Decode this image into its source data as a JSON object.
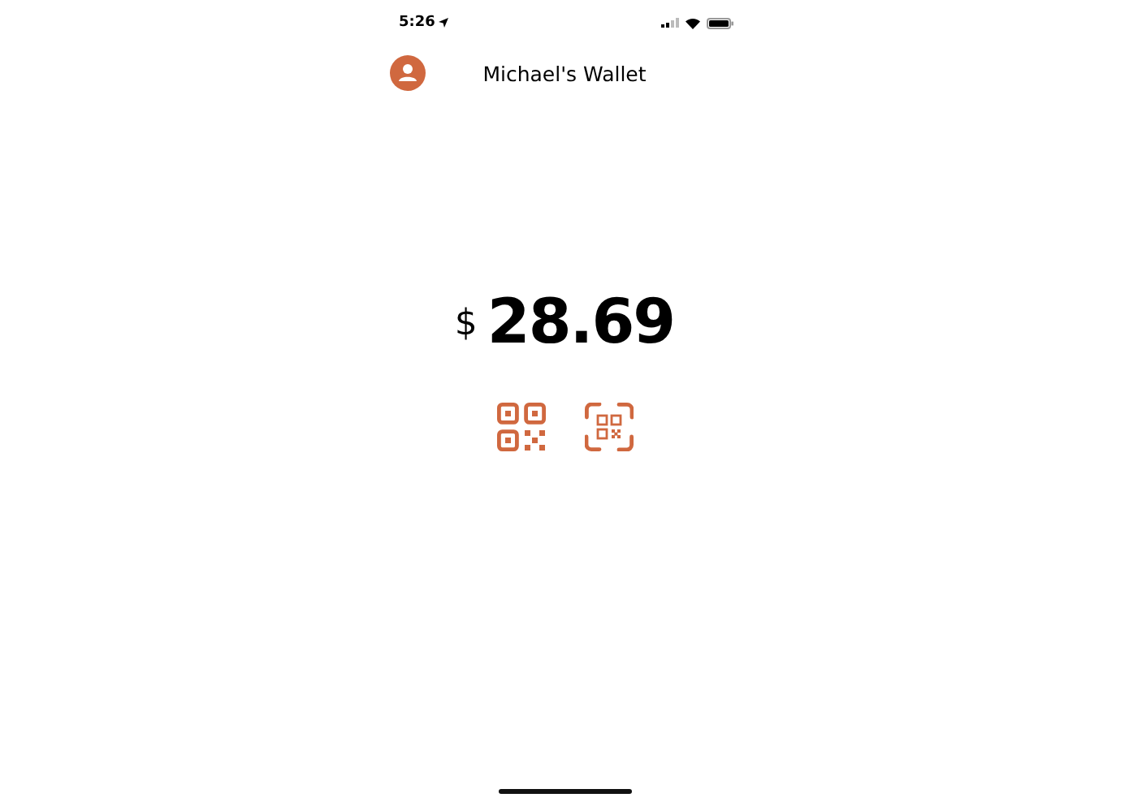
{
  "status_bar": {
    "time": "5:26"
  },
  "header": {
    "title": "Michael's Wallet"
  },
  "balance": {
    "currency": "$",
    "amount": "28.69"
  }
}
